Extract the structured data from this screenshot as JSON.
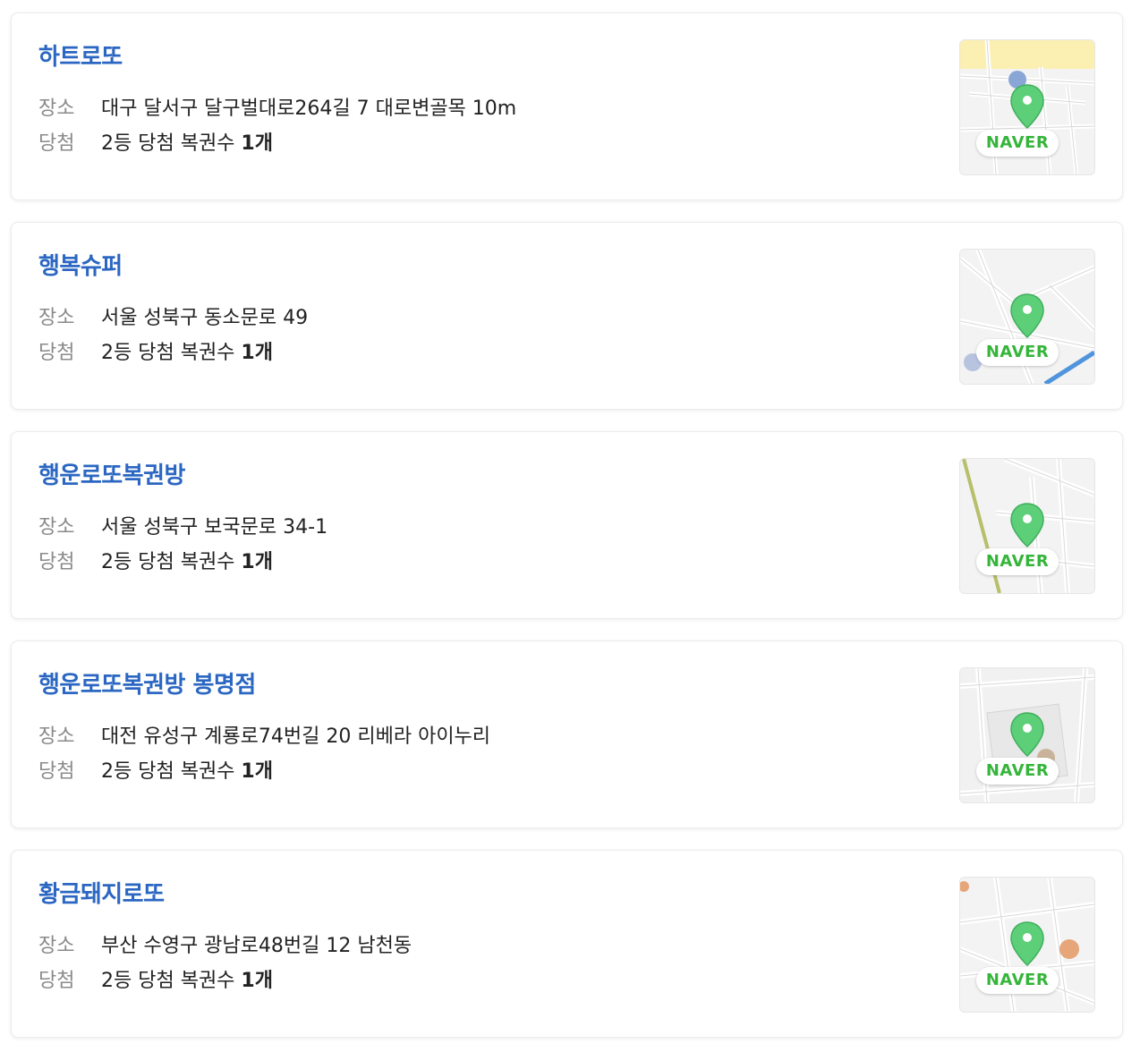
{
  "labels": {
    "address": "장소",
    "win": "당첨",
    "map_badge": "NAVER"
  },
  "colors": {
    "store_name": "#2b67c2",
    "naver_green": "#35b53a",
    "pin_green": "#4cc46a"
  },
  "stores": [
    {
      "name": "하트로또",
      "address": "대구 달서구 달구벌대로264길 7 대로변골목 10m",
      "win_text": "2등 당첨 복권수 ",
      "win_count": "1개"
    },
    {
      "name": "행복슈퍼",
      "address": "서울 성북구 동소문로 49",
      "win_text": "2등 당첨 복권수 ",
      "win_count": "1개"
    },
    {
      "name": "행운로또복권방",
      "address": "서울 성북구 보국문로 34-1",
      "win_text": "2등 당첨 복권수 ",
      "win_count": "1개"
    },
    {
      "name": "행운로또복권방 봉명점",
      "address": "대전 유성구 계룡로74번길 20 리베라 아이누리",
      "win_text": "2등 당첨 복권수 ",
      "win_count": "1개"
    },
    {
      "name": "황금돼지로또",
      "address": "부산 수영구 광남로48번길 12 남천동",
      "win_text": "2등 당첨 복권수 ",
      "win_count": "1개"
    }
  ]
}
